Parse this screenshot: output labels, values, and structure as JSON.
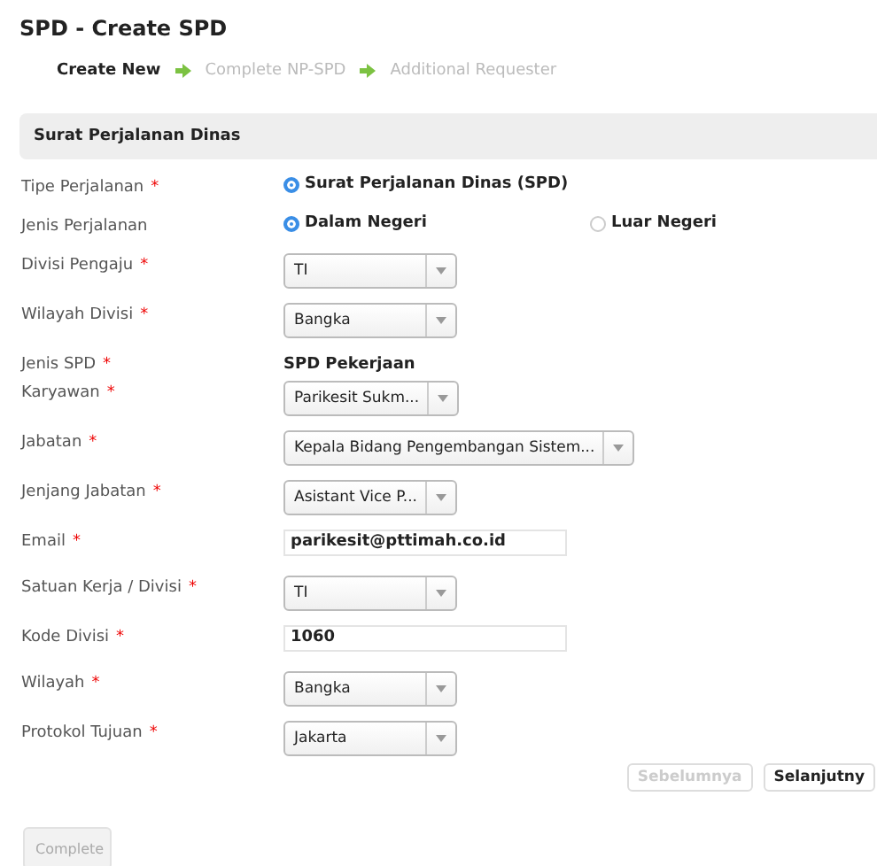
{
  "page_title": "SPD - Create SPD",
  "steps": [
    {
      "label": "Create New",
      "selected": true
    },
    {
      "label": "Complete NP-SPD",
      "selected": false
    },
    {
      "label": "Additional Requester",
      "selected": false
    }
  ],
  "section": {
    "title": "Surat Perjalanan Dinas"
  },
  "fields": [
    {
      "label": "Tipe Perjalanan",
      "marker": "*",
      "kind": "radio",
      "options": [
        {
          "label": "Surat Perjalanan Dinas (SPD)",
          "selected": true
        }
      ]
    },
    {
      "label": "Jenis Perjalanan",
      "kind": "radio",
      "options": [
        {
          "label": "Dalam Negeri",
          "selected": true
        },
        {
          "label": "Luar Negeri",
          "selected": false
        }
      ]
    },
    {
      "label": "Divisi Pengaju",
      "marker": "*",
      "kind": "select",
      "value": "TI"
    },
    {
      "label": "Wilayah Divisi",
      "marker": "*",
      "kind": "select",
      "value": "Bangka"
    },
    {
      "label": "Jenis SPD",
      "marker": "*",
      "kind": "text",
      "value": "SPD Pekerjaan"
    },
    {
      "label": "Karyawan",
      "marker": "*",
      "kind": "select",
      "value": "Parikesit Sukm..."
    },
    {
      "label": "Jabatan",
      "marker": "*",
      "kind": "select_wide",
      "value": "Kepala Bidang Pengembangan Sistem..."
    },
    {
      "label": "Jenjang Jabatan",
      "marker": "*",
      "kind": "select",
      "value": "Asistant Vice P..."
    },
    {
      "label": "Email",
      "marker": "*",
      "kind": "input",
      "value": "parikesit@pttimah.co.id"
    },
    {
      "label": "Satuan Kerja / Divisi",
      "marker": "*",
      "kind": "select",
      "value": "TI"
    },
    {
      "label": "Kode Divisi",
      "marker": "*",
      "kind": "input",
      "value": "1060"
    },
    {
      "label": "Wilayah",
      "marker": "*",
      "kind": "select",
      "value": "Bangka"
    },
    {
      "label": "Protokol Tujuan",
      "marker": "*",
      "kind": "select",
      "value": "Jakarta"
    }
  ],
  "nav_buttons": [
    {
      "label": "Sebelumnya",
      "disabled": true
    },
    {
      "label": "Selanjutny",
      "disabled": false
    }
  ],
  "complete_button": {
    "label": "Complete",
    "disabled": true
  }
}
